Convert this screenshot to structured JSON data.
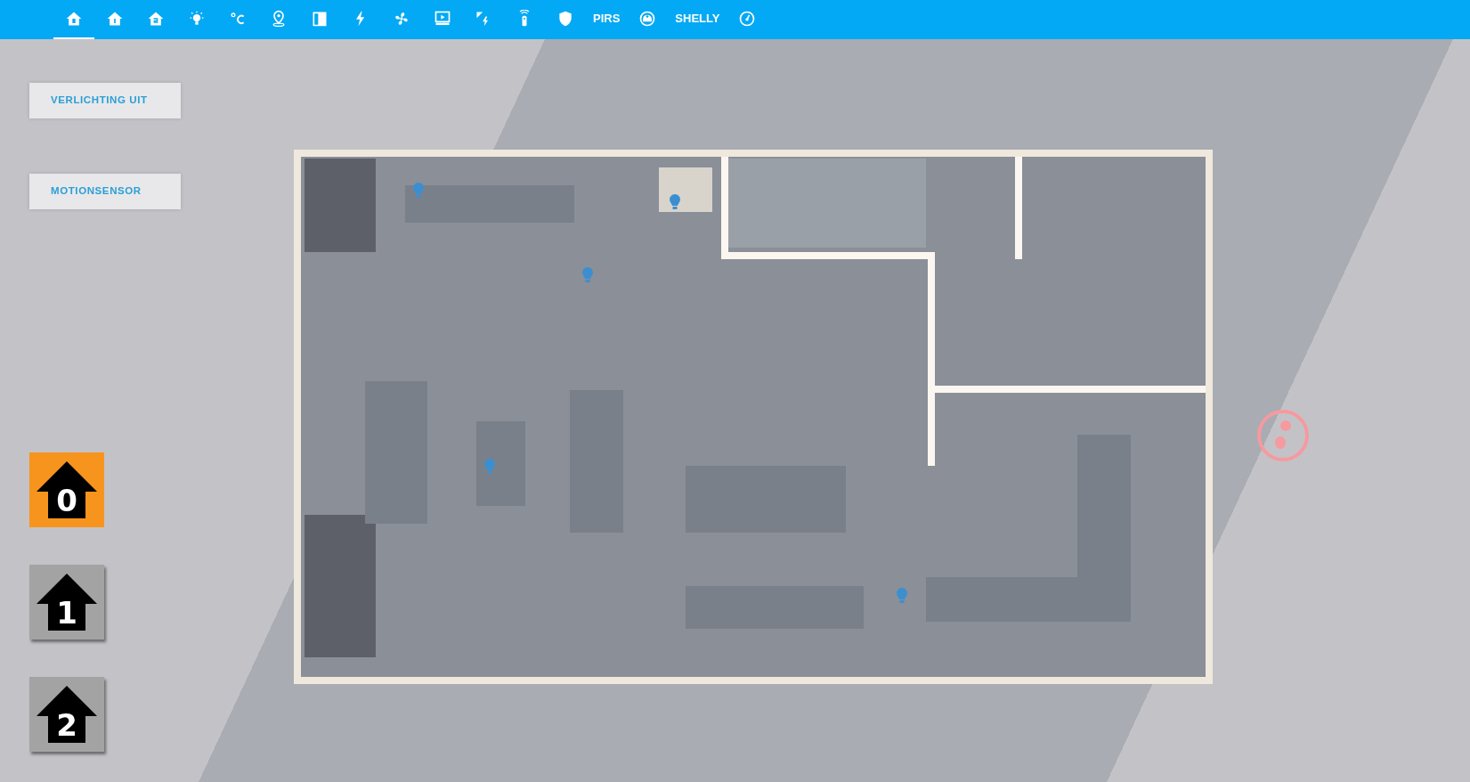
{
  "tabs": [
    {
      "selected": true
    },
    {
      "selected": false
    },
    {
      "selected": false
    },
    {
      "selected": false
    },
    {
      "selected": false
    },
    {
      "selected": false
    },
    {
      "selected": false
    },
    {
      "selected": false
    },
    {
      "selected": false
    },
    {
      "selected": false
    },
    {
      "selected": false
    },
    {
      "selected": false
    },
    {
      "selected": false
    },
    {
      "label": "PIRS",
      "selected": false
    },
    {
      "selected": false
    },
    {
      "label": "SHELLY",
      "selected": false
    },
    {
      "selected": false
    }
  ],
  "buttons": [
    {
      "label": "VERLICHTING UIT"
    },
    {
      "label": "MOTIONSENSOR"
    }
  ],
  "floors": [
    {
      "label": "0",
      "selected": true
    },
    {
      "label": "1",
      "selected": false
    },
    {
      "label": "2",
      "selected": false
    }
  ]
}
